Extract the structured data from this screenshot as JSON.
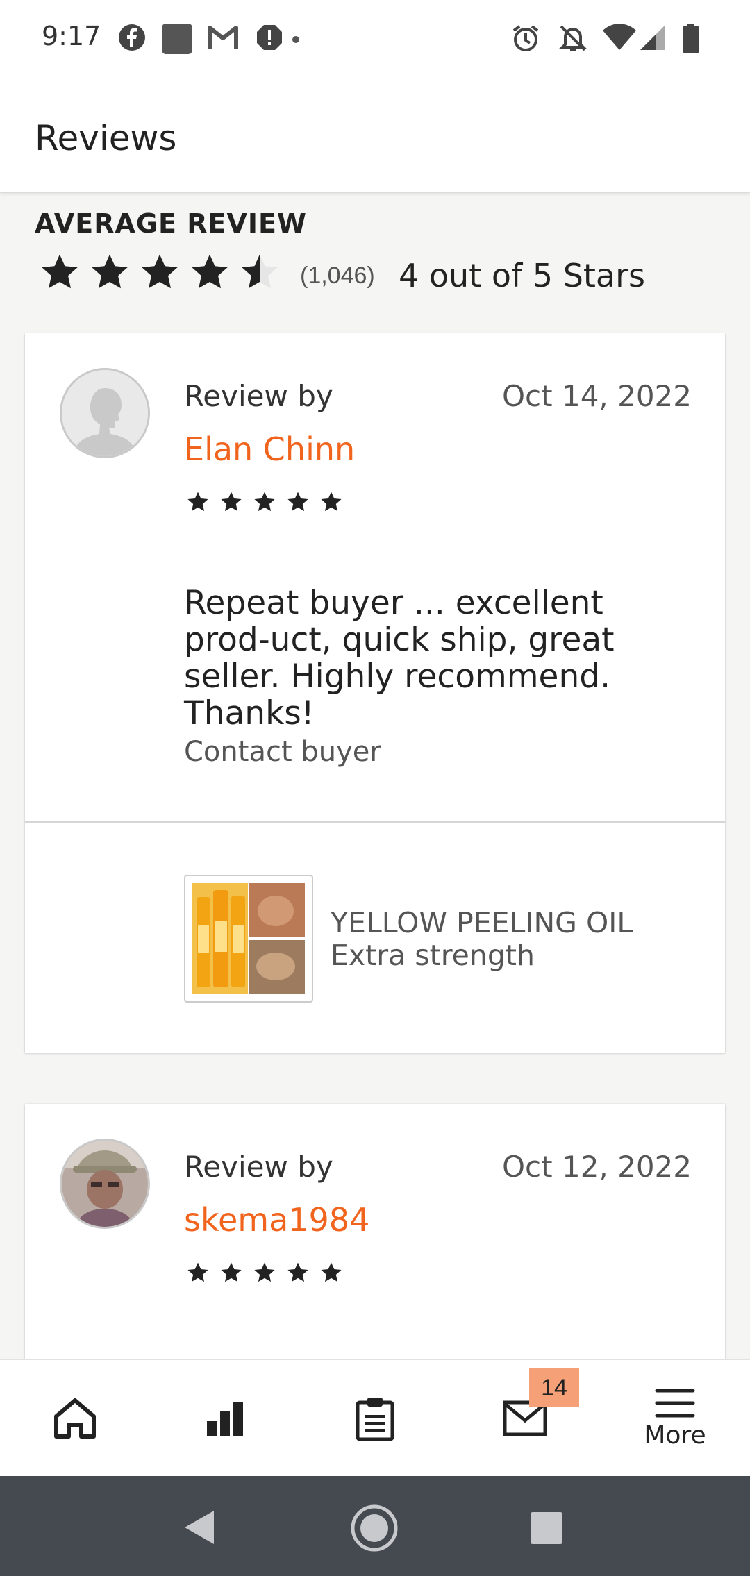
{
  "status_bar": {
    "time": "9:17",
    "left_icons": [
      "facebook-icon",
      "app-square-icon",
      "gmail-icon",
      "alert-icon",
      "dot-icon"
    ],
    "right_icons": [
      "alarm-icon",
      "notifications-off-icon",
      "wifi-icon",
      "signal-icon",
      "battery-icon"
    ]
  },
  "app_bar": {
    "title": "Reviews"
  },
  "average": {
    "heading": "AVERAGE REVIEW",
    "rating": 4.5,
    "count": "(1,046)",
    "text": "4 out of 5 Stars"
  },
  "reviews": [
    {
      "review_by": "Review by",
      "reviewer": "Elan Chinn",
      "date": "Oct 14, 2022",
      "stars": 5,
      "text": "Repeat buyer ... excellent prod-uct, quick ship, great seller. Highly recommend.  Thanks!",
      "contact": "Contact buyer",
      "item": {
        "line1": "YELLOW PEELING OIL",
        "line2": "Extra strength"
      }
    },
    {
      "review_by": "Review by",
      "reviewer": "skema1984",
      "date": "Oct 12, 2022",
      "stars": 5
    }
  ],
  "bottom_nav": {
    "items": [
      "home-icon",
      "stats-icon",
      "orders-icon",
      "messages-icon",
      "menu-icon"
    ],
    "badge": "14",
    "more_label": "More"
  },
  "system_nav": [
    "back-icon",
    "home-circle-icon",
    "recents-icon"
  ],
  "colors": {
    "accent": "#f1641e",
    "badge": "#f6a077",
    "sysnav": "#454a51"
  }
}
